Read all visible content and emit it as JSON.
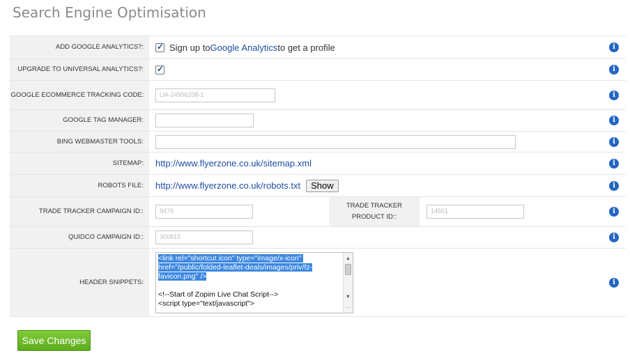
{
  "page": {
    "title": "Search Engine Optimisation"
  },
  "rows": {
    "add_ga": {
      "label": "ADD GOOGLE ANALYTICS?:",
      "checked": true,
      "text_pre": "Sign up to ",
      "link": "Google Analytics",
      "text_post": " to get a profile"
    },
    "upgrade_ua": {
      "label": "UPGRADE TO UNIVERSAL ANALYTICS?:",
      "checked": true
    },
    "ecommerce": {
      "label": "GOOGLE ECOMMERCE TRACKING CODE:",
      "value": "UA-24956208-1"
    },
    "gtm": {
      "label": "GOOGLE TAG MANAGER:",
      "value": ""
    },
    "bing": {
      "label": "BING WEBMASTER TOOLS:",
      "value": ""
    },
    "sitemap": {
      "label": "SITEMAP:",
      "url": "http://www.flyerzone.co.uk/sitemap.xml"
    },
    "robots": {
      "label": "ROBOTS FILE:",
      "url": "http://www.flyerzone.co.uk/robots.txt",
      "button": "Show"
    },
    "tradetracker": {
      "label": "TRADE TRACKER CAMPAIGN ID::",
      "value": "9479",
      "product_label": "TRADE TRACKER PRODUCT ID::",
      "product_value": "14501"
    },
    "quidco": {
      "label": "QUIDCO CAMPAIGN ID::",
      "value": "300815"
    },
    "header": {
      "label": "HEADER SNIPPETS:",
      "selected_text": "<link rel=\"shortcut icon\" type=\"image/x-icon\" href=\"/public/folded-leaflet-deals/images/priv/fz-favicon.png\" />",
      "rest_text": "\n\n<!--Start of Zopim Live Chat Script-->\n<script type=\"text/javascript\">"
    }
  },
  "info_icon": "info-icon",
  "save_label": "Save Changes",
  "colors": {
    "save_button": "#6cbd2a",
    "link": "#1f4ea3",
    "info": "#2466c2"
  }
}
